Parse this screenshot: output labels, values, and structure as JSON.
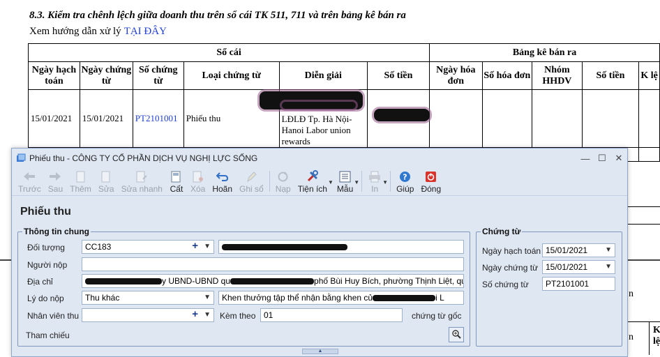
{
  "doc": {
    "heading": "8.3. Kiểm tra chênh lệch giữa doanh thu trên sổ cái TK 511, 711 và trên bảng kê bán ra",
    "guide_text": "Xem hướng dẫn xử lý",
    "guide_link": "TẠI ĐÂY",
    "table": {
      "group_left": "Sổ cái",
      "group_right": "Bảng kê bán ra",
      "headers": [
        "Ngày hạch toán",
        "Ngày chứng từ",
        "Số chứng từ",
        "Loại chứng từ",
        "Diễn giải",
        "Số tiền",
        "Ngày hóa đơn",
        "Số hóa đơn",
        "Nhóm HHDV",
        "Số tiền",
        "K lệ"
      ],
      "row": {
        "ngay_hach_toan": "15/01/2021",
        "ngay_chung_tu": "15/01/2021",
        "so_chung_tu": "PT2101001",
        "loai_chung_tu": "Phiếu thu",
        "dien_giai": "LĐLĐ Tp. Hà Nội-Hanoi Labor union rewards"
      }
    },
    "side_fragment_1": "n",
    "side_fragment_2": "n",
    "side_header_fragment": "K lệ"
  },
  "dialog": {
    "title": "Phiếu thu - CÔNG TY CỔ PHẦN DỊCH VỤ NGHỊ LỰC SỐNG",
    "window_buttons": {
      "minimize": "—",
      "maximize": "☐",
      "close": "✕"
    },
    "toolbar": [
      {
        "label": "Trước",
        "icon": "arrow-left-icon",
        "enabled": false
      },
      {
        "label": "Sau",
        "icon": "arrow-right-icon",
        "enabled": false
      },
      {
        "label": "Thêm",
        "icon": "add-document-icon",
        "enabled": false
      },
      {
        "label": "Sửa",
        "icon": "edit-document-icon",
        "enabled": false
      },
      {
        "label": "Sửa nhanh",
        "icon": "quick-edit-icon",
        "enabled": false
      },
      {
        "label": "Cất",
        "icon": "save-icon",
        "enabled": true
      },
      {
        "label": "Xóa",
        "icon": "delete-icon",
        "enabled": false
      },
      {
        "label": "Hoãn",
        "icon": "undo-icon",
        "enabled": true
      },
      {
        "label": "Ghi sổ",
        "icon": "pencil-icon",
        "enabled": false
      },
      {
        "label": "Nạp",
        "icon": "refresh-icon",
        "enabled": false
      },
      {
        "label": "Tiện ích",
        "icon": "tools-icon",
        "enabled": true
      },
      {
        "label": "Mẫu",
        "icon": "template-icon",
        "enabled": true
      },
      {
        "label": "In",
        "icon": "printer-icon",
        "enabled": false
      },
      {
        "label": "Giúp",
        "icon": "help-icon",
        "enabled": true
      },
      {
        "label": "Đóng",
        "icon": "power-icon",
        "enabled": true
      }
    ],
    "form_title": "Phiếu thu",
    "general": {
      "legend": "Thông tin chung",
      "doi_tuong_label": "Đối tượng",
      "doi_tuong_value": "CC183",
      "nguoi_nop_label": "Người nộp",
      "nguoi_nop_value": "",
      "dia_chi_label": "Địa chỉ",
      "dia_chi_value_a": "y UBND-UBND qu",
      "dia_chi_value_b": "phố Bùi Huy Bích, phường Thịnh Liệt, quậ",
      "ly_do_label": "Lý do nộp",
      "ly_do_value": "Thu khác",
      "ly_do_text_a": "Khen thưởng tập thể nhận bằng khen củ",
      "ly_do_text_b": "i L",
      "nhan_vien_label": "Nhân viên thu",
      "nhan_vien_value": "",
      "kem_theo_label": "Kèm theo",
      "kem_theo_value": "01",
      "chung_tu_goc_label": "chứng từ gốc",
      "tham_chieu_label": "Tham chiếu"
    },
    "voucher": {
      "legend": "Chứng từ",
      "ngay_hach_toan_label": "Ngày hạch toán",
      "ngay_hach_toan_value": "15/01/2021",
      "ngay_chung_tu_label": "Ngày chứng từ",
      "ngay_chung_tu_value": "15/01/2021",
      "so_chung_tu_label": "Số chứng từ",
      "so_chung_tu_value": "PT2101001"
    },
    "colors": {
      "window_bg": "#dfe7f3",
      "group_border": "#7f97bd",
      "link_blue": "#1f3fd6"
    }
  }
}
